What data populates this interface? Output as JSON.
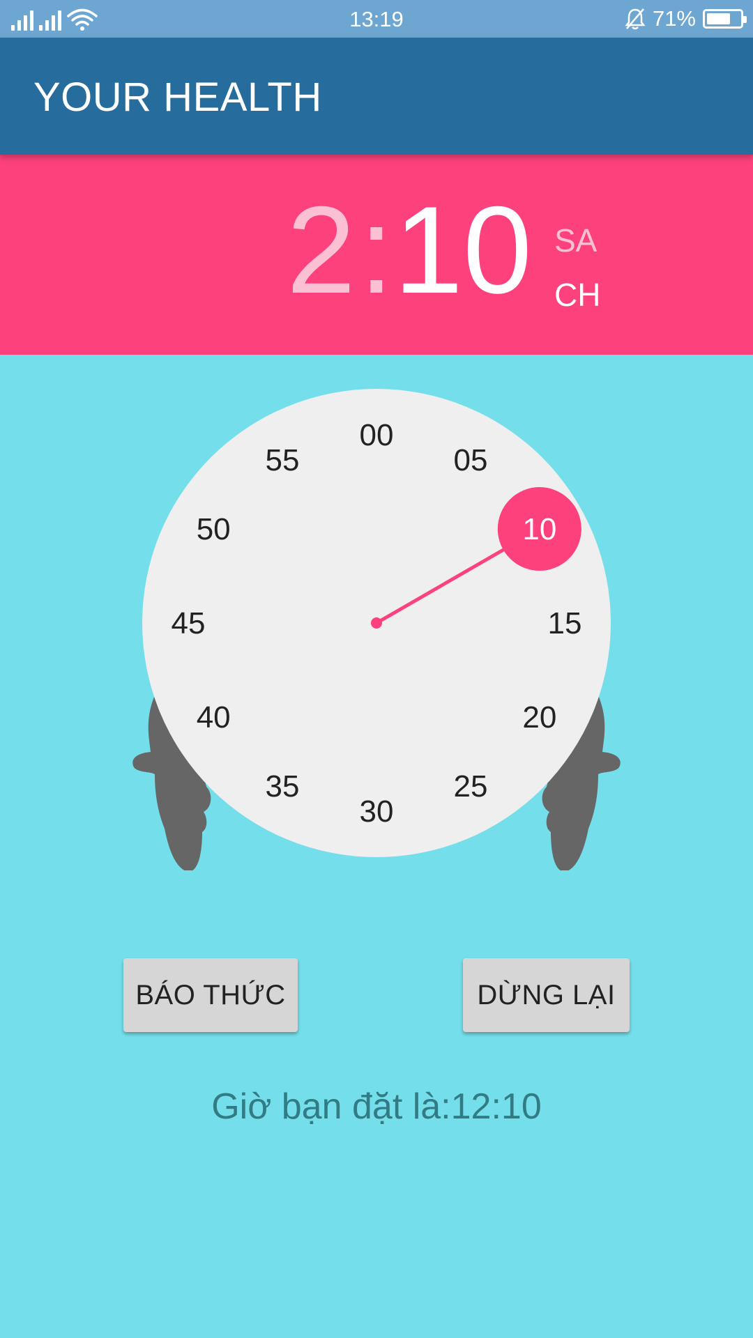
{
  "status_bar": {
    "time": "13:19",
    "battery_percent": "71%",
    "battery_level": 0.71,
    "icons": [
      "signal-icon",
      "signal-icon",
      "wifi-icon",
      "bell-off-icon",
      "battery-icon"
    ]
  },
  "toolbar": {
    "title": "YOUR HEALTH"
  },
  "time_header": {
    "hour": "2",
    "separator": ":",
    "minute": "10",
    "am_label": "SA",
    "pm_label": "CH"
  },
  "clock": {
    "labels": [
      "00",
      "05",
      "10",
      "15",
      "20",
      "25",
      "30",
      "35",
      "40",
      "45",
      "50",
      "55"
    ],
    "selected_minute": 10,
    "selected_label": "10",
    "colors": {
      "face": "#efefef",
      "accent": "#fd417c",
      "text": "#222222",
      "ears": "#666666"
    }
  },
  "buttons": {
    "alarm_label": "BÁO THỨC",
    "stop_label": "DỪNG LẠI"
  },
  "result": {
    "text": "Giờ bạn đặt là:12:10"
  },
  "colors": {
    "status_bar": "#6ea6d2",
    "toolbar": "#266c9d",
    "header": "#fd417c",
    "background": "#74deeb"
  }
}
